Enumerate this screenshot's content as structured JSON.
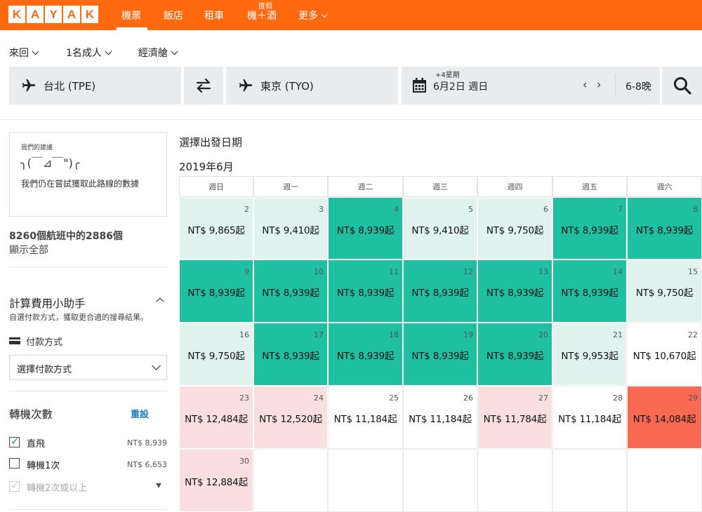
{
  "brand": {
    "letters": [
      "K",
      "A",
      "Y",
      "A",
      "K"
    ],
    "accent": "#ff690f"
  },
  "nav": {
    "flights": "機票",
    "hotels": "飯店",
    "cars": "租車",
    "packages": "機＋酒",
    "packages_badge": "度假",
    "more": "更多"
  },
  "options": {
    "trip_type": "來回",
    "travelers": "1名成人",
    "cabin": "經濟艙"
  },
  "search": {
    "origin": "台北 (TPE)",
    "destination": "東京 (TYO)",
    "flex_note": "+4星期",
    "date": "6月2日 週日",
    "nights": "6-8晚",
    "icons": [
      "plane-icon",
      "swap-icon",
      "calendar-icon",
      "search-icon"
    ]
  },
  "sidebar": {
    "tip_title": "我們的建議",
    "tip_emoji": "╮(￣⊿￣\")╭",
    "tip_body": "我們仍在嘗試獲取此路線的數據",
    "result_count": "8260個航班中的2886個",
    "show_all": "顯示全部",
    "fee_title": "計算費用小助手",
    "fee_desc": "自選付款方式，獲取更合適的搜尋結果。",
    "payment_label": "付款方式",
    "payment_select": "選擇付款方式",
    "stops_title": "轉機次數",
    "reset": "重設",
    "stops": [
      {
        "label": "直飛",
        "price": "NT$ 8,939",
        "checked": true
      },
      {
        "label": "轉機1次",
        "price": "NT$ 6,653",
        "checked": false
      },
      {
        "label": "轉機2次或以上",
        "price": "",
        "checked": true,
        "disabled": true
      }
    ]
  },
  "calendar": {
    "title": "選擇出發日期",
    "month": "2019年6月",
    "weekdays": [
      "週日",
      "週一",
      "週二",
      "週三",
      "週四",
      "週五",
      "週六"
    ],
    "colors": {
      "mint": "#e0f3ef",
      "teal": "#1fc0a2",
      "pink": "#f9e0de",
      "red": "#fa6a53"
    },
    "weeks": [
      [
        {
          "day": "2",
          "price": "NT$ 9,865起",
          "tone": "mint"
        },
        {
          "day": "3",
          "price": "NT$ 9,410起",
          "tone": "mint"
        },
        {
          "day": "4",
          "price": "NT$ 8,939起",
          "tone": "teal"
        },
        {
          "day": "5",
          "price": "NT$ 9,410起",
          "tone": "mint"
        },
        {
          "day": "6",
          "price": "NT$ 9,750起",
          "tone": "mint"
        },
        {
          "day": "7",
          "price": "NT$ 8,939起",
          "tone": "teal"
        },
        {
          "day": "8",
          "price": "NT$ 8,939起",
          "tone": "teal"
        }
      ],
      [
        {
          "day": "9",
          "price": "NT$ 8,939起",
          "tone": "teal"
        },
        {
          "day": "10",
          "price": "NT$ 8,939起",
          "tone": "teal"
        },
        {
          "day": "11",
          "price": "NT$ 8,939起",
          "tone": "teal"
        },
        {
          "day": "12",
          "price": "NT$ 8,939起",
          "tone": "teal"
        },
        {
          "day": "13",
          "price": "NT$ 8,939起",
          "tone": "teal"
        },
        {
          "day": "14",
          "price": "NT$ 8,939起",
          "tone": "teal"
        },
        {
          "day": "15",
          "price": "NT$ 9,750起",
          "tone": "mint"
        }
      ],
      [
        {
          "day": "16",
          "price": "NT$ 9,750起",
          "tone": "mint"
        },
        {
          "day": "17",
          "price": "NT$ 8,939起",
          "tone": "teal"
        },
        {
          "day": "18",
          "price": "NT$ 8,939起",
          "tone": "teal"
        },
        {
          "day": "19",
          "price": "NT$ 8,939起",
          "tone": "teal"
        },
        {
          "day": "20",
          "price": "NT$ 8,939起",
          "tone": "teal"
        },
        {
          "day": "21",
          "price": "NT$ 9,953起",
          "tone": "mint"
        },
        {
          "day": "22",
          "price": "NT$ 10,670起",
          "tone": "white"
        }
      ],
      [
        {
          "day": "23",
          "price": "NT$ 12,484起",
          "tone": "pink"
        },
        {
          "day": "24",
          "price": "NT$ 12,520起",
          "tone": "pink"
        },
        {
          "day": "25",
          "price": "NT$ 11,184起",
          "tone": "white"
        },
        {
          "day": "26",
          "price": "NT$ 11,184起",
          "tone": "white"
        },
        {
          "day": "27",
          "price": "NT$ 11,784起",
          "tone": "pink"
        },
        {
          "day": "28",
          "price": "NT$ 11,184起",
          "tone": "white"
        },
        {
          "day": "29",
          "price": "NT$ 14,084起",
          "tone": "red"
        }
      ],
      [
        {
          "day": "30",
          "price": "NT$ 12,884起",
          "tone": "pink"
        },
        {
          "day": "",
          "price": "",
          "tone": "empty"
        },
        {
          "day": "",
          "price": "",
          "tone": "empty"
        },
        {
          "day": "",
          "price": "",
          "tone": "empty"
        },
        {
          "day": "",
          "price": "",
          "tone": "empty"
        },
        {
          "day": "",
          "price": "",
          "tone": "empty"
        },
        {
          "day": "",
          "price": "",
          "tone": "empty"
        }
      ]
    ]
  }
}
